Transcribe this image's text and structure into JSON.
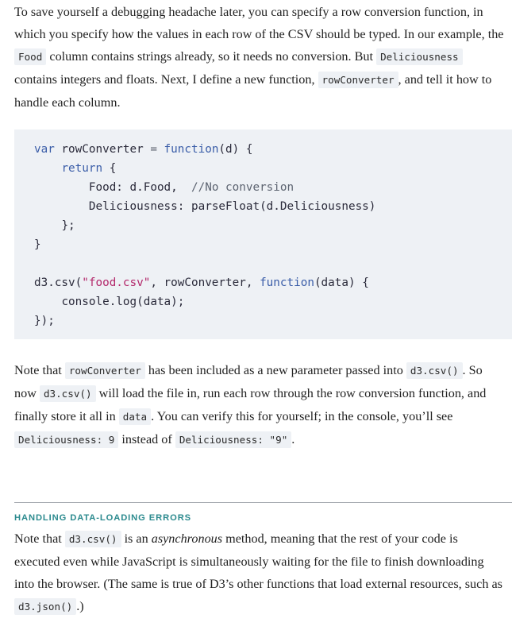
{
  "intro": {
    "t1": "To save yourself a debugging headache later, you can specify a row conversion function, in which you specify how the values in each row of the CSV should be typed. In our example, the ",
    "c1": "Food",
    "t2": " column contains strings already, so it needs no conversion. But ",
    "c2": "Deliciousness",
    "t3": " contains integers and floats. Next, I define a new function, ",
    "c3": "rowConverter",
    "t4": ", and tell it how to handle each column."
  },
  "code": {
    "l1_kw": "var",
    "l1_name": " rowConverter ",
    "l1_eq": "=",
    "l1_fn": " function",
    "l1_rest": "(d) {",
    "l2_kw": "return",
    "l2_rest": " {",
    "l3_key": "Food: d.Food,  ",
    "l3_comment": "//No conversion",
    "l4_key": "Deliciousness: ",
    "l4_rest": "parseFloat(d.Deliciousness)",
    "l5": "};",
    "l6": "}",
    "l8_a": "d3.csv(",
    "l8_str": "\"food.csv\"",
    "l8_b": ", rowConverter, ",
    "l8_fn": "function",
    "l8_c": "(data) {",
    "l9": "console.log(data);",
    "l10": "});"
  },
  "note1": {
    "t1": "Note that ",
    "c1": "rowConverter",
    "t2": " has been included as a new parameter passed into ",
    "c2": "d3.csv()",
    "t3": ". So now ",
    "c3": "d3.csv()",
    "t4": " will load the file in, run each row through the row conversion function, and finally store it all in ",
    "c4": "data",
    "t5": ". You can verify this for yourself; in the console, you’ll see ",
    "c5": "Deliciousness: 9",
    "t6": " instead of ",
    "c6": "Deliciousness: \"9\"",
    "t7": "."
  },
  "sidebar": {
    "heading": "HANDLING DATA-LOADING ERRORS"
  },
  "note2": {
    "t1": "Note that ",
    "c1": "d3.csv()",
    "t2": " is an ",
    "em1": "asynchronous",
    "t3": " method, meaning that the rest of your code is executed even while JavaScript is simultaneously waiting for the file to finish downloading into the browser. (The same is true of D3’s other functions that load external resources, such as ",
    "c2": "d3.json()",
    "t4": ".)"
  }
}
